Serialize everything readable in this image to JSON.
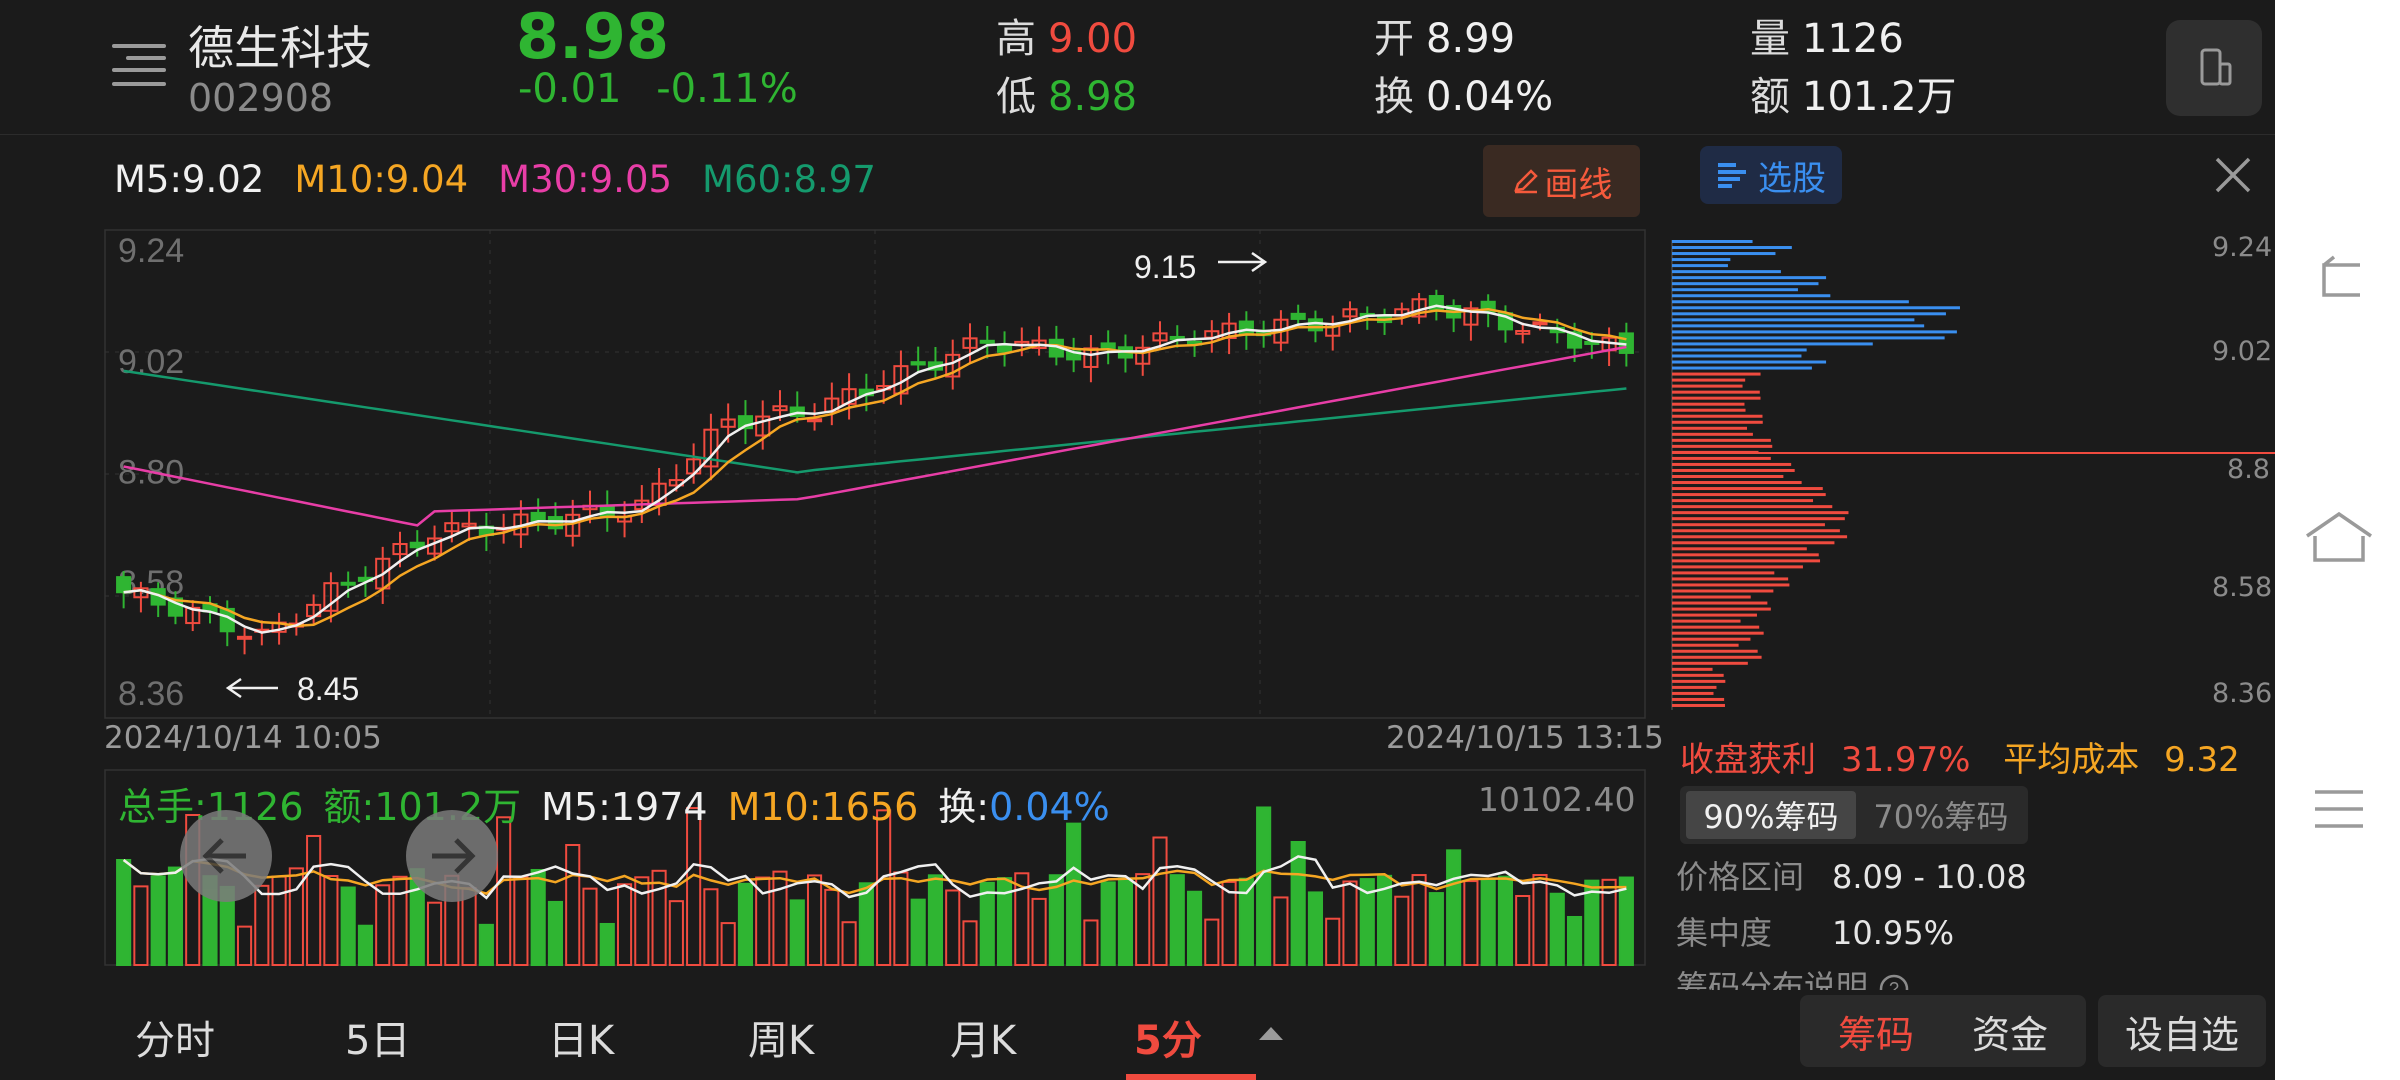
{
  "header": {
    "name": "德生科技",
    "code": "002908",
    "price": "8.98",
    "change": "-0.01",
    "change_pct": "-0.11%",
    "high_label": "高",
    "high": "9.00",
    "low_label": "低",
    "low": "8.98",
    "open_label": "开",
    "open": "8.99",
    "turnover_label": "换",
    "turnover": "0.04%",
    "volume_label": "量",
    "volume": "1126",
    "amount_label": "额",
    "amount": "101.2万"
  },
  "ma": {
    "m5": "M5:9.02",
    "m10": "M10:9.04",
    "m30": "M30:9.05",
    "m60": "M60:8.97"
  },
  "draw_label": "画线",
  "price_ticks": [
    "9.24",
    "9.02",
    "8.80",
    "8.58",
    "8.36"
  ],
  "annotations": {
    "high": "9.15",
    "low": "8.45"
  },
  "dates": {
    "start": "2024/10/14 10:05",
    "end": "2024/10/15 13:15"
  },
  "volume_info": {
    "total": "总手:1126",
    "amount": "额:101.2万",
    "m5": "M5:1974",
    "m10": "M10:1656",
    "turnover_label": "换:",
    "turnover": "0.04%",
    "max": "10102.40"
  },
  "chip": {
    "select_label": "选股",
    "ticks": [
      "9.24",
      "9.02",
      "8.8",
      "8.58",
      "8.36"
    ],
    "profit_label": "收盘获利",
    "profit": "31.97%",
    "avgcost_label": "平均成本",
    "avgcost": "9.32",
    "tab90": "90%筹码",
    "tab70": "70%筹码",
    "range_label": "价格区间",
    "range": "8.09 - 10.08",
    "concentration_label": "集中度",
    "concentration": "10.95%",
    "explain": "筹码分布说明"
  },
  "period_tabs": [
    "分时",
    "5日",
    "日K",
    "周K",
    "月K",
    "5分"
  ],
  "active_tab": "5分",
  "bottom_buttons": {
    "chip": "筹码",
    "fund": "资金",
    "watch": "设自选"
  },
  "colors": {
    "up": "#f04b3f",
    "down": "#2fb532",
    "m5": "#f0f0f0",
    "m10": "#f5a623",
    "m30": "#e83ea7",
    "m60": "#159a6d"
  }
}
